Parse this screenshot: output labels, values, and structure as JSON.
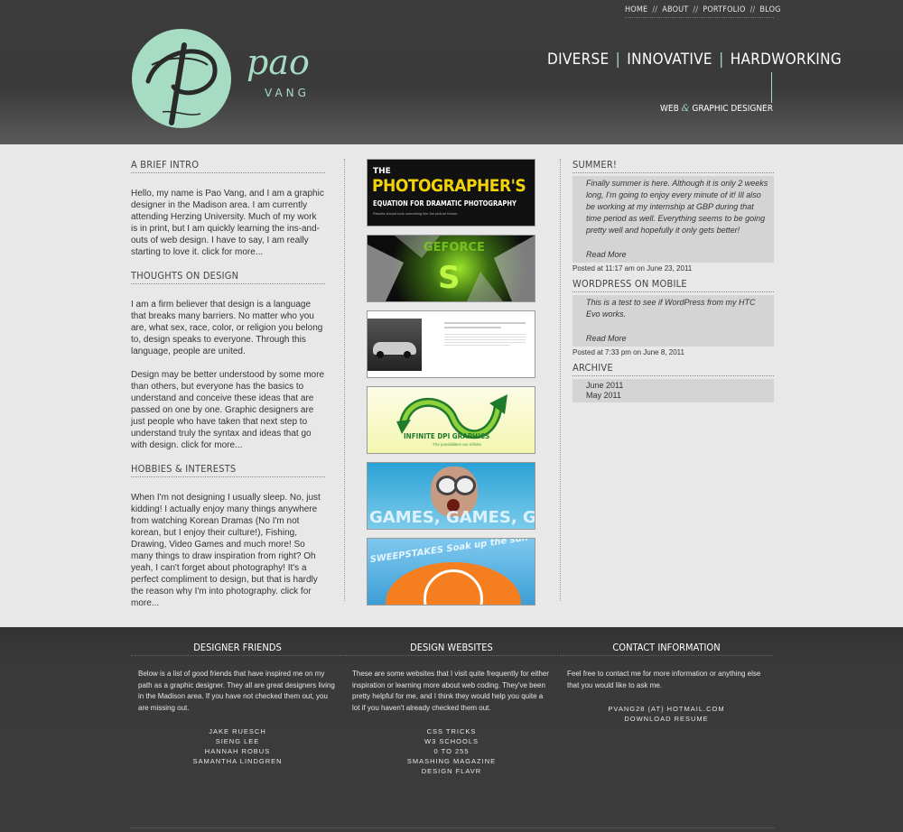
{
  "nav": {
    "items": [
      "HOME",
      "ABOUT",
      "PORTFOLIO",
      "BLOG"
    ],
    "separator": "//"
  },
  "brand": {
    "name": "pao",
    "surname": "VANG"
  },
  "tagline": {
    "part1": "DIVERSE",
    "part2": "INNOVATIVE",
    "part3": "HARDWORKING",
    "bar": "|"
  },
  "subtitle": {
    "left": "WEB",
    "amp": "&",
    "right": "GRAPHIC DESIGNER"
  },
  "intro": {
    "title": "A BRIEF INTRO",
    "text": "Hello, my name is Pao Vang, and I am a graphic designer in the Madison area. I am currently attending Herzing University. Much of my work is in print, but I am quickly learning the ins-and-outs of web design. I have to say, I am really starting to love it. click for more..."
  },
  "thoughts": {
    "title": "THOUGHTS ON DESIGN",
    "p1": "I am a firm believer that design is a language that breaks many barriers. No matter who you are, what sex, race, color, or religion you belong to, design speaks to everyone. Through this language, people are united.",
    "p2": "Design may be better understood by some more than others, but everyone has the basics to understand and conceive these ideas that are passed on one by one. Graphic designers are just people who have taken that next step to understand truly the syntax and ideas that go with design. click for more..."
  },
  "hobbies": {
    "title": "HOBBIES & INTERESTS",
    "text": "When I'm not designing I usually sleep. No, just kidding! I actually enjoy many things anywhere from watching Korean Dramas (No I'm not korean, but I enjoy their culture!), Fishing, Drawing, Video Games and much more! So many things to draw inspiration from right? Oh yeah, I can't forget about photography! It's a perfect compliment to design, but that is hardly the reason why I'm into photography. click for more..."
  },
  "portfolio": {
    "t1_line1": "THE",
    "t1_line2": "PHOTOGRAPHER'S",
    "t1_line3": "EQUATION FOR DRAMATIC PHOTOGRAPHY",
    "t1_line4": "Results should look something like the picture below:",
    "t2_text": "GEFORCE",
    "t4_brand": "INFINITE DPI GRAPHICS",
    "t4_tag": "The possibilities are infinite",
    "t5_text": "GAMES, GAMES, GAMES",
    "t6_text": "SWEEPSTAKES Soak up the sun"
  },
  "blog": {
    "posts": [
      {
        "title": "SUMMER!",
        "text": "Finally summer is here. Although it is only 2 weeks long, I'm going to enjoy every minute of it! Ill also be working at my internship at GBP during that time period as well. Everything seems to be going pretty well and hopefully it only gets better!",
        "more": "Read More",
        "posted": "Posted at 11:17 am on June 23, 2011"
      },
      {
        "title": "WORDPRESS ON MOBILE",
        "text": "This is a test to see if WordPress from my HTC Evo works.",
        "more": "Read More",
        "posted": "Posted at 7:33 pm on June 8, 2011"
      }
    ],
    "archive_title": "ARCHIVE",
    "archive": [
      "June 2011",
      "May 2011"
    ]
  },
  "footer": {
    "friends": {
      "title": "DESIGNER FRIENDS",
      "text": "Below is a list of good friends that have inspired me on my path as a graphic designer. They all are great designers living in the Madison area. If you have not checked them out, you are missing out.",
      "links": [
        "JAKE RUESCH",
        "SIENG LEE",
        "HANNAH ROBUS",
        "SAMANTHA LINDGREN"
      ]
    },
    "websites": {
      "title": "DESIGN WEBSITES",
      "text": "These are some websites that I visit quite frequently for either inspiration or learning more about web coding. They've been pretty helpful for me, and I think they would help you quite a lot if you haven't already checked them out.",
      "links": [
        "CSS TRICKS",
        "W3 SCHOOLS",
        "0 TO 255",
        "SMASHING MAGAZINE",
        "DESIGN FLAVR"
      ]
    },
    "contact": {
      "title": "CONTACT INFORMATION",
      "text": "Feel free to contact me for more information or anything else that you would like to ask me.",
      "links": [
        "PVANG28 (AT) HOTMAIL.COM",
        "DOWNLOAD RESUME"
      ]
    }
  },
  "colors": {
    "accent": "#a7dcc4",
    "header_bg": "#3c3c3c",
    "body_bg": "#e8e8e8",
    "post_bg": "#d4d4d4"
  }
}
